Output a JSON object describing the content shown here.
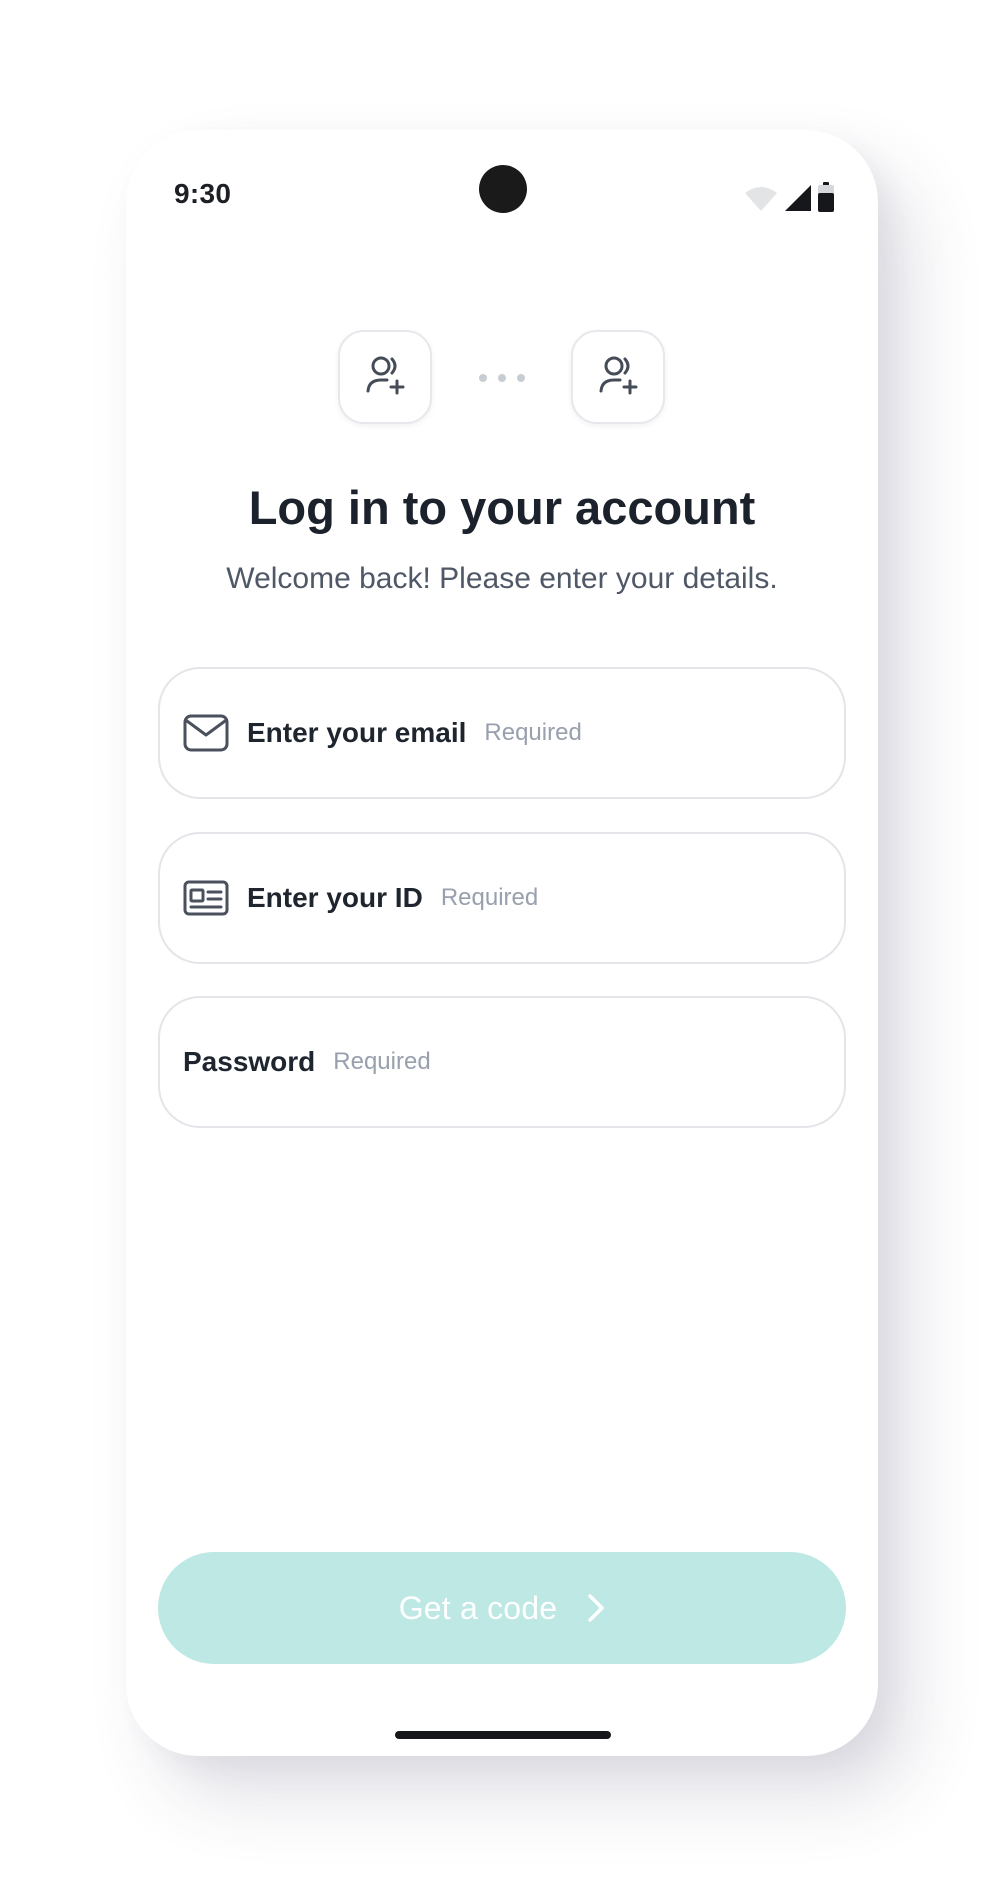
{
  "status_bar": {
    "time": "9:30",
    "icons": [
      "wifi-icon",
      "cellular-signal-icon",
      "battery-icon"
    ]
  },
  "header": {
    "avatar_icons": [
      "user-plus-icon",
      "user-plus-icon"
    ],
    "title": "Log in to your account",
    "subtitle": "Welcome back! Please enter your details."
  },
  "form": {
    "email": {
      "label": "Enter your email",
      "required": "Required",
      "icon": "mail-icon"
    },
    "id": {
      "label": "Enter your ID",
      "required": "Required",
      "icon": "id-card-icon"
    },
    "password": {
      "label": "Password",
      "required": "Required"
    }
  },
  "cta": {
    "label": "Get a code",
    "icon": "chevron-right-icon"
  },
  "colors": {
    "cta_background": "#bde8e4",
    "text_primary": "#1c222b",
    "text_secondary": "#4f5866",
    "placeholder": "#98a0ad"
  }
}
